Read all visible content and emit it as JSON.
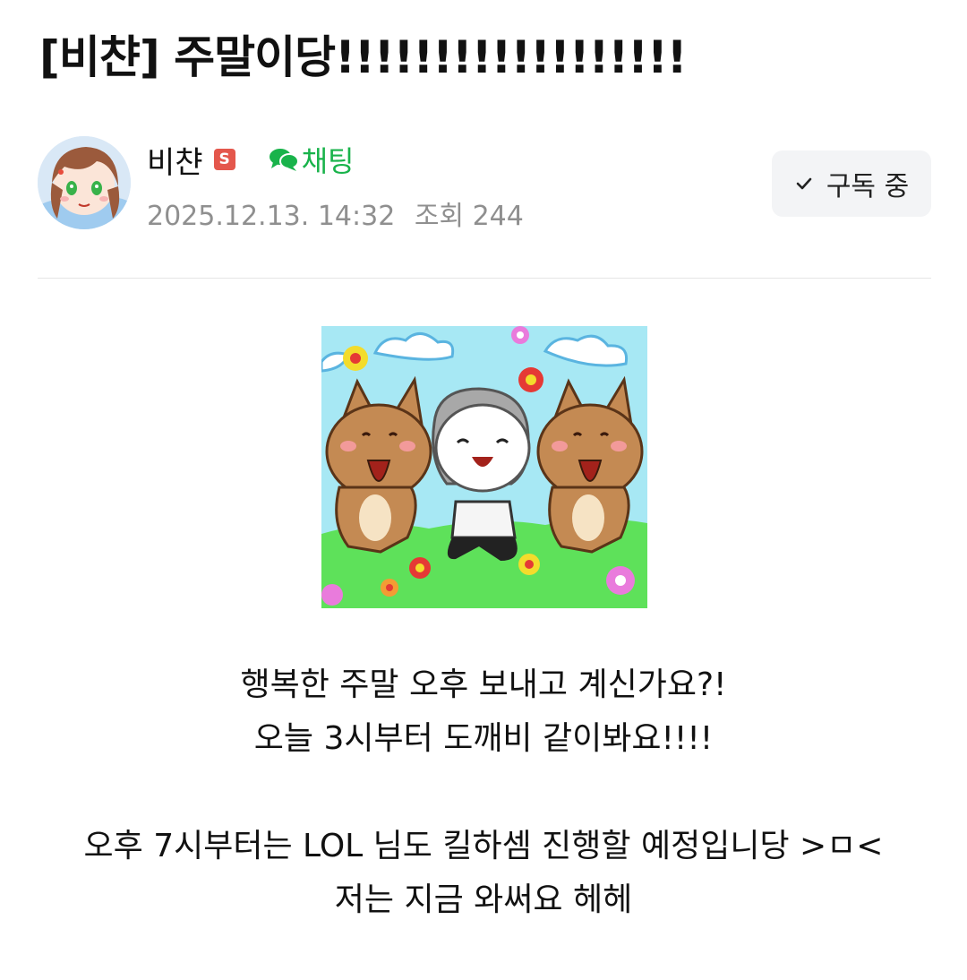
{
  "post": {
    "title": "[비챤] 주말이당!!!!!!!!!!!!!!!!!!",
    "author": {
      "name": "비챤",
      "badge": "S",
      "chat_label": "채팅",
      "date": "2025.12.13. 14:32",
      "views": "조회 244"
    },
    "subscribe_label": "구독 중",
    "body_lines": [
      "행복한 주말 오후 보내고 계신가요?!",
      "오늘 3시부터 도깨비 같이봐요!!!!",
      "",
      "오후 7시부터는 LOL 님도 킬하셈 진행할 예정입니당 >ㅁ<",
      "저는 지금 와써요 헤헤"
    ]
  },
  "colors": {
    "chat_green": "#19b34b",
    "badge_red": "#e4574c",
    "meta_gray": "#8f8f8f",
    "button_bg": "#f3f4f6"
  },
  "icons": {
    "chat": "chat-bubble-icon",
    "check": "check-icon"
  }
}
